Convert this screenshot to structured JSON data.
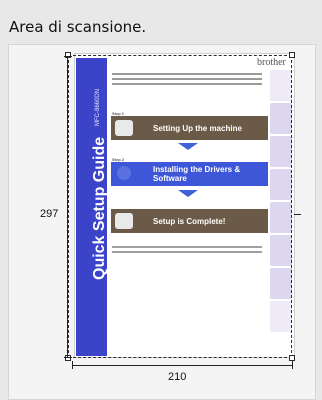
{
  "window": {
    "title": "Area di scansione."
  },
  "dimensions": {
    "height_label": "297",
    "width_label": "210"
  },
  "preview": {
    "brand": "brother",
    "spine_title": "Quick Setup Guide",
    "spine_model": "MFC-8660DN",
    "steps": [
      {
        "label": "Step 1",
        "title": "Setting Up the machine"
      },
      {
        "label": "Step 2",
        "title": "Installing the Drivers & Software"
      },
      {
        "label": "",
        "title": "Setup is Complete!"
      }
    ]
  },
  "colors": {
    "spine": "#3b44c9",
    "step_bar": "#6b5a48",
    "step_bar_highlight": "#3e57d8"
  }
}
